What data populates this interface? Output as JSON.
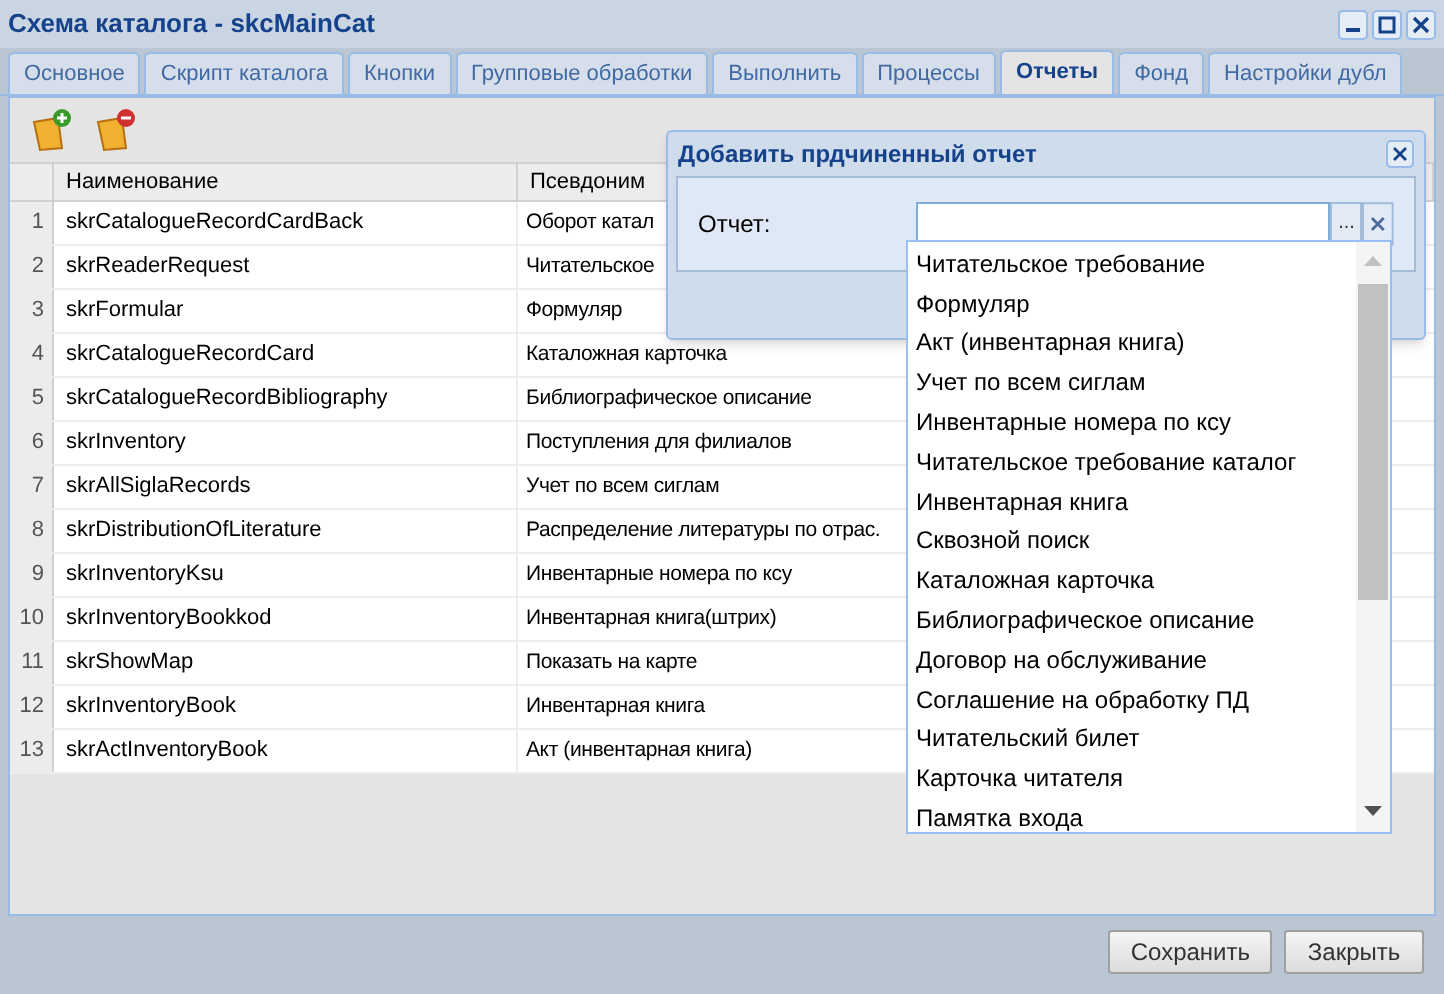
{
  "window": {
    "title": "Схема каталога - skcMainCat"
  },
  "tabs": [
    {
      "label": "Основное",
      "selected": false
    },
    {
      "label": "Скрипт каталога",
      "selected": false
    },
    {
      "label": "Кнопки",
      "selected": false
    },
    {
      "label": "Групповые обработки",
      "selected": false
    },
    {
      "label": "Выполнить",
      "selected": false
    },
    {
      "label": "Процессы",
      "selected": false
    },
    {
      "label": "Отчеты",
      "selected": true
    },
    {
      "label": "Фонд",
      "selected": false
    },
    {
      "label": "Настройки дубл",
      "selected": false
    }
  ],
  "table": {
    "columns": [
      "Наименование",
      "Псевдоним"
    ],
    "rows": [
      {
        "number": "1",
        "name": "skrCatalogueRecordCardBack",
        "alias": "Оборот катал"
      },
      {
        "number": "2",
        "name": "skrReaderRequest",
        "alias": "Читательское"
      },
      {
        "number": "3",
        "name": "skrFormular",
        "alias": "Формуляр"
      },
      {
        "number": "4",
        "name": "skrCatalogueRecordCard",
        "alias": "Каталожная карточка"
      },
      {
        "number": "5",
        "name": "skrCatalogueRecordBibliography",
        "alias": "Библиографическое описание"
      },
      {
        "number": "6",
        "name": "skrInventory",
        "alias": "Поступления для филиалов"
      },
      {
        "number": "7",
        "name": "skrAllSiglaRecords",
        "alias": "Учет по всем сиглам"
      },
      {
        "number": "8",
        "name": "skrDistributionOfLiterature",
        "alias": "Распределение литературы по отрас."
      },
      {
        "number": "9",
        "name": "skrInventoryKsu",
        "alias": "Инвентарные номера по ксу"
      },
      {
        "number": "10",
        "name": "skrInventoryBookkod",
        "alias": "Инвентарная книга(штрих)"
      },
      {
        "number": "11",
        "name": "skrShowMap",
        "alias": "Показать на карте"
      },
      {
        "number": "12",
        "name": "skrInventoryBook",
        "alias": "Инвентарная книга"
      },
      {
        "number": "13",
        "name": "skrActInventoryBook",
        "alias": "Акт (инвентарная книга)"
      }
    ]
  },
  "dialog": {
    "title": "Добавить прдчиненный отчет",
    "field_label": "Отчет:",
    "browse_button": "...",
    "options": [
      "Читательское требование",
      "Формуляр",
      "Акт (инвентарная книга)",
      "Учет по всем сиглам",
      "Инвентарные номера по ксу",
      "Читательское требование каталог",
      "Инвентарная книга",
      "Сквозной поиск",
      "Каталожная карточка",
      "Библиографическое описание",
      "Договор на обслуживание",
      "Соглашение на обработку ПД",
      "Читательский билет",
      "Карточка читателя",
      "Памятка входа"
    ]
  },
  "buttons": [
    "Сохранить",
    "Закрыть"
  ]
}
